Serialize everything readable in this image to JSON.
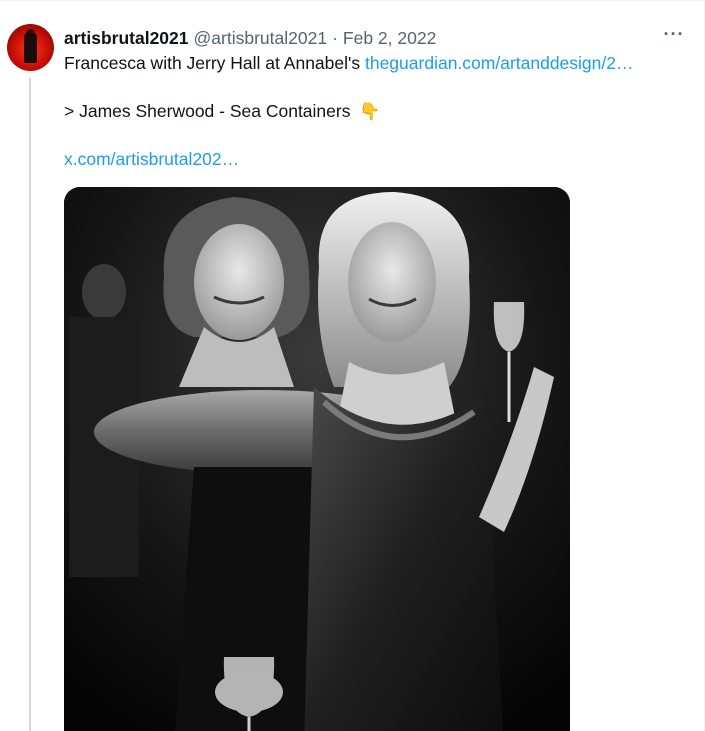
{
  "tweet": {
    "display_name": "artisbrutal2021",
    "handle": "@artisbrutal2021",
    "separator": "·",
    "date": "Feb 2, 2022",
    "more_icon": "more-horizontal-icon",
    "more_label": "···",
    "line1_text": "Francesca with Jerry Hall at Annabel's ",
    "line1_link": "theguardian.com/artanddesign/2…",
    "line2_text": "> James Sherwood  - Sea Containers ",
    "line2_emoji": "👇",
    "line3_link": "x.com/artisbrutal202…",
    "link_color": "#1d9bf0",
    "media": {
      "kind": "black-and-white photo",
      "icon": "photo"
    }
  }
}
